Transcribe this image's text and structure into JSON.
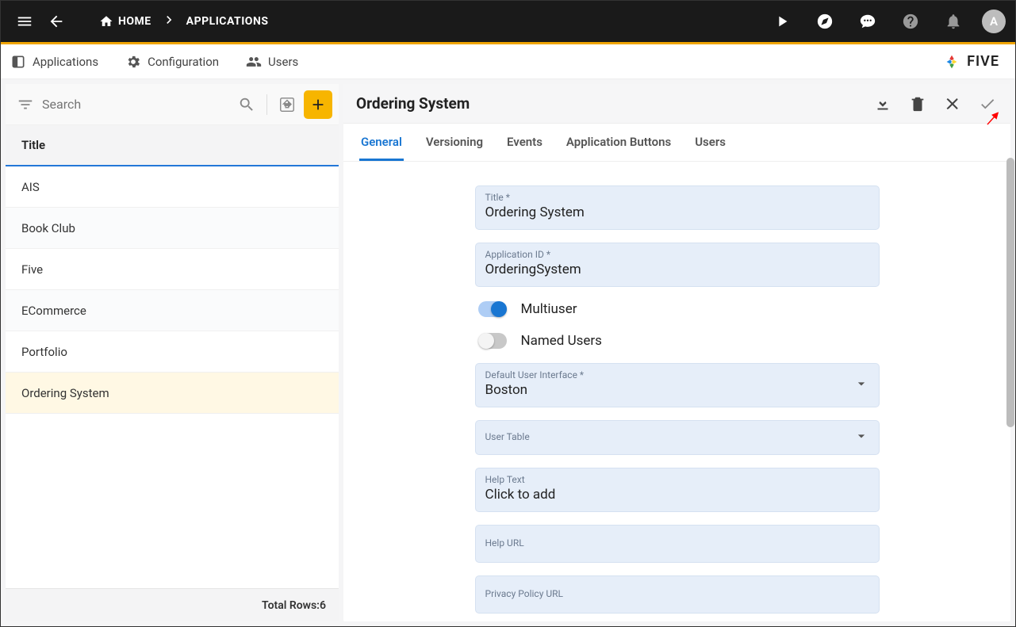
{
  "topbar": {
    "home_label": "HOME",
    "applications_label": "APPLICATIONS",
    "avatar_letter": "A"
  },
  "tabs": {
    "applications": "Applications",
    "configuration": "Configuration",
    "users": "Users"
  },
  "brand": "FIVE",
  "search": {
    "placeholder": "Search"
  },
  "list": {
    "column_header": "Title",
    "rows": [
      "AIS",
      "Book Club",
      "Five",
      "ECommerce",
      "Portfolio",
      "Ordering System"
    ],
    "selected_index": 5,
    "footer_prefix": "Total Rows: ",
    "footer_count": "6"
  },
  "detail": {
    "title": "Ordering System",
    "subtabs": [
      "General",
      "Versioning",
      "Events",
      "Application Buttons",
      "Users"
    ],
    "active_subtab": 0,
    "fields": {
      "title": {
        "label": "Title *",
        "value": "Ordering System"
      },
      "app_id": {
        "label": "Application ID *",
        "value": "OrderingSystem"
      },
      "multiuser": {
        "label": "Multiuser",
        "on": true
      },
      "named_users": {
        "label": "Named Users",
        "on": false
      },
      "default_ui": {
        "label": "Default User Interface *",
        "value": "Boston"
      },
      "user_table": {
        "label": "User Table",
        "value": ""
      },
      "help_text": {
        "label": "Help Text",
        "value": "Click to add"
      },
      "help_url": {
        "label": "Help URL",
        "value": ""
      },
      "privacy_url": {
        "label": "Privacy Policy URL",
        "value": ""
      }
    }
  }
}
